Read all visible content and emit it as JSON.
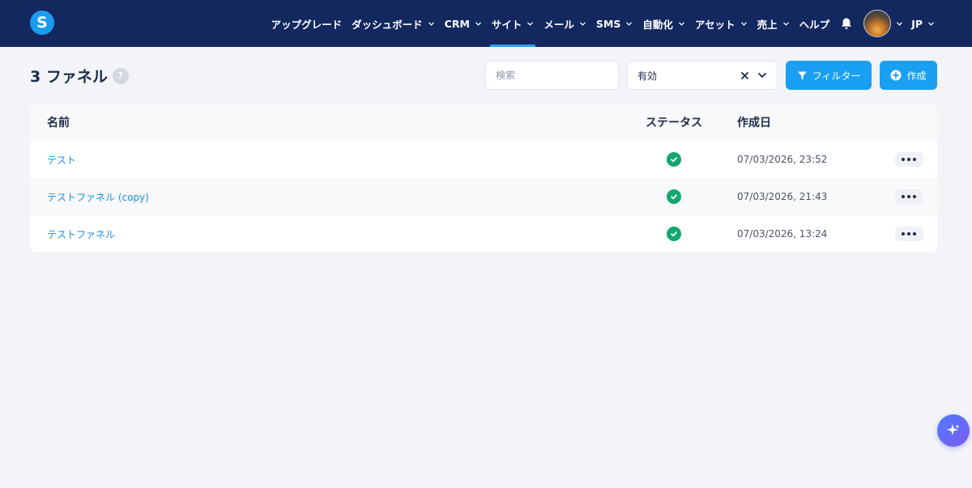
{
  "nav": {
    "logo_letter": "S",
    "items": [
      {
        "label": "アップグレード",
        "dropdown": false,
        "active": false
      },
      {
        "label": "ダッシュボード",
        "dropdown": true,
        "active": false
      },
      {
        "label": "CRM",
        "dropdown": true,
        "active": false
      },
      {
        "label": "サイト",
        "dropdown": true,
        "active": true
      },
      {
        "label": "メール",
        "dropdown": true,
        "active": false
      },
      {
        "label": "SMS",
        "dropdown": true,
        "active": false
      },
      {
        "label": "自動化",
        "dropdown": true,
        "active": false
      },
      {
        "label": "アセット",
        "dropdown": true,
        "active": false
      },
      {
        "label": "売上",
        "dropdown": true,
        "active": false
      },
      {
        "label": "ヘルプ",
        "dropdown": false,
        "active": false
      }
    ],
    "language": "JP",
    "bar_color": "#13285e",
    "accent_color": "#2aa3ff"
  },
  "header": {
    "title": "3 ファネル",
    "help_icon": "?",
    "search_placeholder": "検索",
    "status_filter_value": "有効",
    "filter_button_label": "フィルター",
    "create_button_label": "作成",
    "button_color": "#1aa0f3"
  },
  "table": {
    "columns": {
      "name": "名前",
      "status": "ステータス",
      "created": "作成日"
    },
    "rows": [
      {
        "name": "テスト",
        "status": "active",
        "created": "07/03/2026, 23:52"
      },
      {
        "name": "テストファネル (copy)",
        "status": "active",
        "created": "07/03/2026, 21:43"
      },
      {
        "name": "テストファネル",
        "status": "active",
        "created": "07/03/2026, 13:24"
      }
    ],
    "status_color": "#12a86f",
    "link_color": "#1a90d8"
  }
}
